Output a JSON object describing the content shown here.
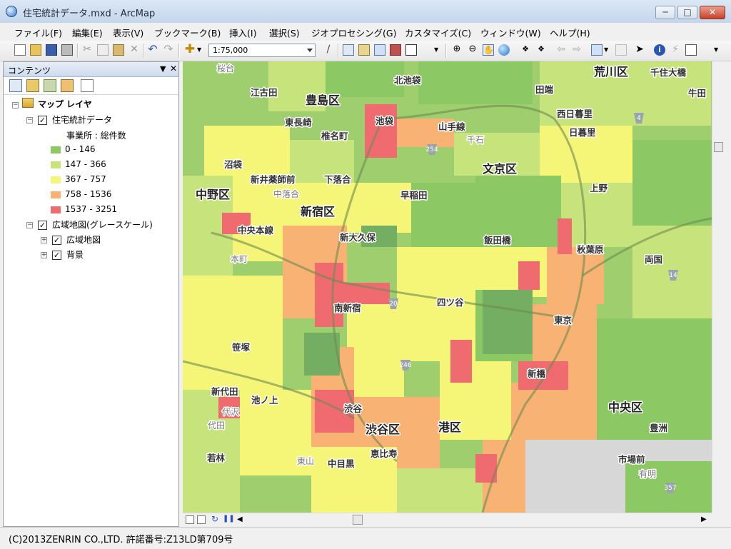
{
  "window": {
    "title": "住宅統計データ.mxd - ArcMap"
  },
  "menu": [
    "ファイル(F)",
    "編集(E)",
    "表示(V)",
    "ブックマーク(B)",
    "挿入(I)",
    "選択(S)",
    "ジオプロセシング(G)",
    "カスタマイズ(C)",
    "ウィンドウ(W)",
    "ヘルプ(H)"
  ],
  "toolbar": {
    "scale": "1:75,000"
  },
  "toc": {
    "title": "コンテンツ",
    "root": "マップ レイヤ",
    "layer1": {
      "name": "住宅統計データ",
      "field": "事業所 : 総件数",
      "classes": [
        {
          "label": "0 - 146",
          "color": "#8cc864"
        },
        {
          "label": "147 - 366",
          "color": "#c7e47c"
        },
        {
          "label": "367 - 757",
          "color": "#f5f577"
        },
        {
          "label": "758 - 1536",
          "color": "#f8b274"
        },
        {
          "label": "1537 - 3251",
          "color": "#ef6b70"
        }
      ]
    },
    "layer2": {
      "name": "広域地図(グレースケール)",
      "children": [
        "広域地図",
        "背景"
      ]
    }
  },
  "map": {
    "wards": [
      "豊島区",
      "荒川区",
      "文京区",
      "中野区",
      "新宿区",
      "渋谷区",
      "港区",
      "中央区"
    ],
    "stations": [
      "桜台",
      "北池袋",
      "千住大橋",
      "江古田",
      "田端",
      "牛田",
      "西日暮里",
      "東長崎",
      "池袋",
      "日暮里",
      "椎名町",
      "山手線",
      "千石",
      "沼袋",
      "新井薬師前",
      "下落合",
      "上野",
      "早稲田",
      "中央本線",
      "新大久保",
      "飯田橋",
      "秋葉原",
      "両国",
      "本町",
      "南新宿",
      "四ツ谷",
      "東京",
      "笹塚",
      "新橋",
      "新代田",
      "池ノ上",
      "代田",
      "代沢",
      "渋谷",
      "恵比寿",
      "豊洲",
      "若林",
      "東山",
      "中目黒",
      "市場前",
      "有明",
      "中落合"
    ],
    "routes": [
      "254",
      "4",
      "20",
      "14",
      "246",
      "357"
    ]
  },
  "status": {
    "copyright": "(C)2013ZENRIN CO.,LTD. 許諾番号:Z13LD第709号"
  }
}
